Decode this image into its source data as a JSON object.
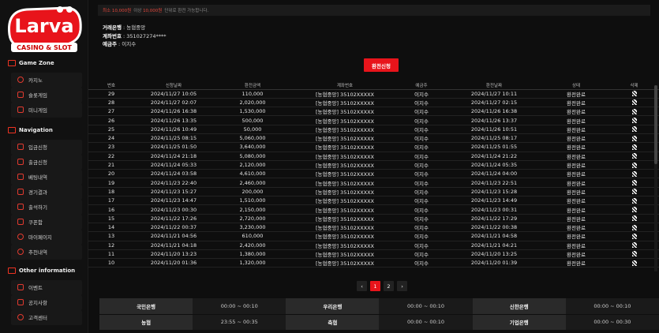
{
  "logo": {
    "line1": "Larva",
    "line2": "CASINO & SLOT"
  },
  "sidebar": {
    "sections": [
      {
        "title": "Game Zone",
        "items": [
          {
            "label": "카지노"
          },
          {
            "label": "슬롯게임"
          },
          {
            "label": "미니게임"
          }
        ]
      },
      {
        "title": "Navigation",
        "items": [
          {
            "label": "입금신청"
          },
          {
            "label": "출금신청"
          },
          {
            "label": "베팅내역"
          },
          {
            "label": "경기결과"
          },
          {
            "label": "출석하기"
          },
          {
            "label": "쿠폰함"
          },
          {
            "label": "마이페이지"
          },
          {
            "label": "추천내역"
          }
        ]
      },
      {
        "title": "Other information",
        "items": [
          {
            "label": "이벤트"
          },
          {
            "label": "공지사항"
          },
          {
            "label": "고객센터"
          }
        ]
      }
    ]
  },
  "notice": {
    "min_label": "최소",
    "min_value": "10,000원",
    "unit_label": "이상",
    "unit_value": "10,000원",
    "suffix": "단위로 환전 가능합니다."
  },
  "account": {
    "bank_label": "거래은행",
    "bank_value": "농협중앙",
    "number_label": "계좌번호",
    "number_value": "351027274****",
    "holder_label": "예금주",
    "holder_value": "이지수"
  },
  "exchange_button": "환전신청",
  "table": {
    "headers": [
      "번호",
      "신청날짜",
      "환전금액",
      "계좌번호",
      "예금주",
      "환전날짜",
      "상태",
      "삭제"
    ],
    "rows": [
      [
        "29",
        "2024/11/27 10:05",
        "110,000",
        "[농협중앙] 35102XXXXX",
        "이지수",
        "2024/11/27 10:11",
        "환전완료"
      ],
      [
        "28",
        "2024/11/27 02:07",
        "2,020,000",
        "[농협중앙] 35102XXXXX",
        "이지수",
        "2024/11/27 02:15",
        "환전완료"
      ],
      [
        "27",
        "2024/11/26 16:38",
        "1,530,000",
        "[농협중앙] 35102XXXXX",
        "이지수",
        "2024/11/26 16:38",
        "환전완료"
      ],
      [
        "26",
        "2024/11/26 13:35",
        "500,000",
        "[농협중앙] 35102XXXXX",
        "이지수",
        "2024/11/26 13:37",
        "환전완료"
      ],
      [
        "25",
        "2024/11/26 10:49",
        "50,000",
        "[농협중앙] 35102XXXXX",
        "이지수",
        "2024/11/26 10:51",
        "환전완료"
      ],
      [
        "24",
        "2024/11/25 08:15",
        "5,060,000",
        "[농협중앙] 35102XXXXX",
        "이지수",
        "2024/11/25 08:17",
        "환전완료"
      ],
      [
        "23",
        "2024/11/25 01:50",
        "3,640,000",
        "[농협중앙] 35102XXXXX",
        "이지수",
        "2024/11/25 01:55",
        "환전완료"
      ],
      [
        "22",
        "2024/11/24 21:18",
        "5,080,000",
        "[농협중앙] 35102XXXXX",
        "이지수",
        "2024/11/24 21:22",
        "환전완료"
      ],
      [
        "21",
        "2024/11/24 05:33",
        "2,120,000",
        "[농협중앙] 35102XXXXX",
        "이지수",
        "2024/11/24 05:35",
        "환전완료"
      ],
      [
        "20",
        "2024/11/24 03:58",
        "4,610,000",
        "[농협중앙] 35102XXXXX",
        "이지수",
        "2024/11/24 04:00",
        "환전완료"
      ],
      [
        "19",
        "2024/11/23 22:40",
        "2,460,000",
        "[농협중앙] 35102XXXXX",
        "이지수",
        "2024/11/23 22:51",
        "환전완료"
      ],
      [
        "18",
        "2024/11/23 15:27",
        "200,000",
        "[농협중앙] 35102XXXXX",
        "이지수",
        "2024/11/23 15:28",
        "환전완료"
      ],
      [
        "17",
        "2024/11/23 14:47",
        "1,510,000",
        "[농협중앙] 35102XXXXX",
        "이지수",
        "2024/11/23 14:49",
        "환전완료"
      ],
      [
        "16",
        "2024/11/23 00:30",
        "2,150,000",
        "[농협중앙] 35102XXXXX",
        "이지수",
        "2024/11/23 00:31",
        "환전완료"
      ],
      [
        "15",
        "2024/11/22 17:26",
        "2,720,000",
        "[농협중앙] 35102XXXXX",
        "이지수",
        "2024/11/22 17:29",
        "환전완료"
      ],
      [
        "14",
        "2024/11/22 00:37",
        "3,230,000",
        "[농협중앙] 35102XXXXX",
        "이지수",
        "2024/11/22 00:38",
        "환전완료"
      ],
      [
        "13",
        "2024/11/21 04:56",
        "610,000",
        "[농협중앙] 35102XXXXX",
        "이지수",
        "2024/11/21 04:58",
        "환전완료"
      ],
      [
        "12",
        "2024/11/21 04:18",
        "2,420,000",
        "[농협중앙] 35102XXXXX",
        "이지수",
        "2024/11/21 04:21",
        "환전완료"
      ],
      [
        "11",
        "2024/11/20 13:23",
        "1,380,000",
        "[농협중앙] 35102XXXXX",
        "이지수",
        "2024/11/20 13:25",
        "환전완료"
      ],
      [
        "10",
        "2024/11/20 01:36",
        "1,320,000",
        "[농협중앙] 35102XXXXX",
        "이지수",
        "2024/11/20 01:39",
        "환전완료"
      ]
    ]
  },
  "pagination": {
    "prev": "‹",
    "pages": [
      "1",
      "2"
    ],
    "active": "1",
    "next": "›"
  },
  "banks": [
    [
      {
        "name": "국민은행",
        "time": "00:00 ~ 00:10"
      },
      {
        "name": "우리은행",
        "time": "00:00 ~ 00:10"
      },
      {
        "name": "신한은행",
        "time": "00:00 ~ 00:10"
      }
    ],
    [
      {
        "name": "농협",
        "time": "23:55 ~ 00:35"
      },
      {
        "name": "축협",
        "time": "00:00 ~ 00:10"
      },
      {
        "name": "기업은행",
        "time": "00:00 ~ 00:30"
      }
    ]
  ],
  "colors": {
    "accent": "#e8141b",
    "background": "#0e0e0e",
    "sidebar": "#111111"
  },
  "icons": {
    "section": "menu-box-icon",
    "item": "outline-icon",
    "delete": "delete-checkbox-icon"
  }
}
